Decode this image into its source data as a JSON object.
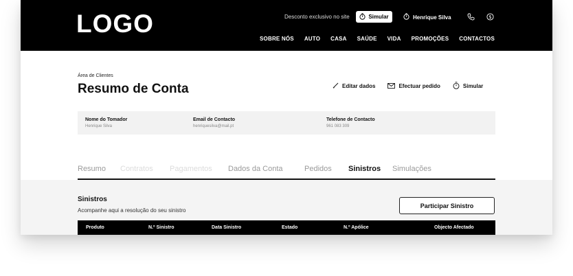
{
  "header": {
    "logo": "LOGO",
    "promo_text": "Desconto exclusivo no site",
    "simular_label": "Simular",
    "user_name": "Henrique Silva",
    "nav": [
      "SOBRE NÓS",
      "AUTO",
      "CASA",
      "SAÚDE",
      "VIDA",
      "PROMOÇÕES",
      "CONTACTOS"
    ]
  },
  "area": {
    "breadcrumb": "Área de Clientes",
    "title": "Resumo de Conta",
    "actions": {
      "edit": "Editar dados",
      "request": "Efectuar pedido",
      "simulate": "Simular"
    }
  },
  "info": [
    {
      "label": "Nome do Tomador",
      "value": "Henrique Silva"
    },
    {
      "label": "Email de Contacto",
      "value": "henriquesilva@mail.pt"
    },
    {
      "label": "Telefone de Contacto",
      "value": "961 083 309"
    }
  ],
  "tabs": [
    {
      "label": "Resumo",
      "state": "normal"
    },
    {
      "label": "Contratos",
      "state": "disabled"
    },
    {
      "label": "Pagamentos",
      "state": "disabled"
    },
    {
      "label": "Dados da Conta",
      "state": "normal"
    },
    {
      "label": "Pedidos",
      "state": "normal"
    },
    {
      "label": "Sinistros",
      "state": "active"
    },
    {
      "label": "Simulações",
      "state": "normal"
    }
  ],
  "sinistros": {
    "title": "Sinistros",
    "subtitle": "Acompanhe aqui a resolução do seu sinistro",
    "button": "Participar Sinistro",
    "columns": [
      "Produto",
      "N.º Sinistro",
      "Data Sinistro",
      "Estado",
      "N.º Apólice",
      "Objecto Afectado"
    ]
  },
  "colors": {
    "header_bg": "#000000",
    "tab_normal": "#9a9a9a",
    "tab_disabled": "#dcdcdc",
    "tab_active": "#111111",
    "panel_bg": "#f2f2f2"
  }
}
